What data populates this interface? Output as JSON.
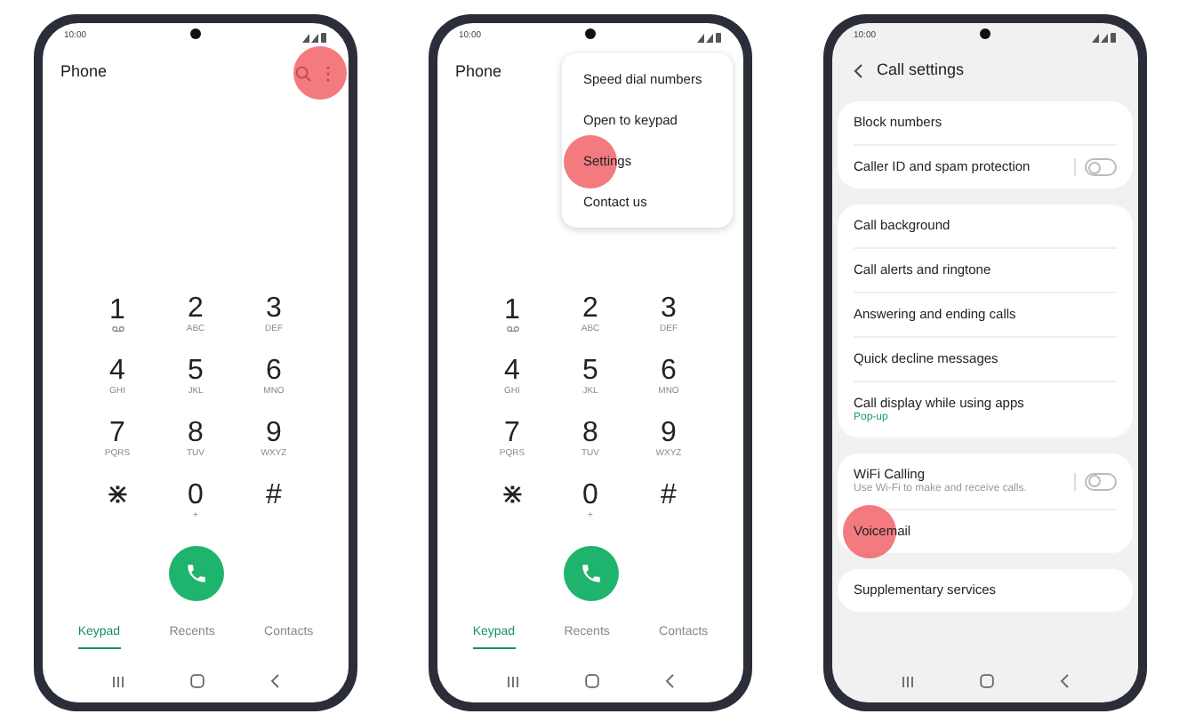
{
  "phones": [
    {
      "kind": "dialer",
      "status_time": "10:00",
      "title": "Phone",
      "more_tapped": true,
      "keys": [
        {
          "digit": "1",
          "kind": "voicemail"
        },
        {
          "digit": "2",
          "kind": "letters",
          "letters": "ABC"
        },
        {
          "digit": "3",
          "kind": "letters",
          "letters": "DEF"
        },
        {
          "digit": "4",
          "kind": "letters",
          "letters": "GHI"
        },
        {
          "digit": "5",
          "kind": "letters",
          "letters": "JKL"
        },
        {
          "digit": "6",
          "kind": "letters",
          "letters": "MNO"
        },
        {
          "digit": "7",
          "kind": "letters",
          "letters": "PQRS"
        },
        {
          "digit": "8",
          "kind": "letters",
          "letters": "TUV"
        },
        {
          "digit": "9",
          "kind": "letters",
          "letters": "WXYZ"
        },
        {
          "digit": "⋇",
          "kind": "plain"
        },
        {
          "digit": "0",
          "kind": "letters",
          "letters": "+"
        },
        {
          "digit": "#",
          "kind": "plain"
        }
      ],
      "tabs": [
        {
          "label": "Keypad",
          "selected": true
        },
        {
          "label": "Recents",
          "selected": false
        },
        {
          "label": "Contacts",
          "selected": false
        }
      ]
    },
    {
      "kind": "dialer",
      "status_time": "10:00",
      "title": "Phone",
      "menu": [
        {
          "label": "Speed dial numbers",
          "tapped": false
        },
        {
          "label": "Open to keypad",
          "tapped": false
        },
        {
          "label": "Settings",
          "tapped": true
        },
        {
          "label": "Contact us",
          "tapped": false
        }
      ],
      "keys": [
        {
          "digit": "1",
          "kind": "voicemail"
        },
        {
          "digit": "2",
          "kind": "letters",
          "letters": "ABC"
        },
        {
          "digit": "3",
          "kind": "letters",
          "letters": "DEF"
        },
        {
          "digit": "4",
          "kind": "letters",
          "letters": "GHI"
        },
        {
          "digit": "5",
          "kind": "letters",
          "letters": "JKL"
        },
        {
          "digit": "6",
          "kind": "letters",
          "letters": "MNO"
        },
        {
          "digit": "7",
          "kind": "letters",
          "letters": "PQRS"
        },
        {
          "digit": "8",
          "kind": "letters",
          "letters": "TUV"
        },
        {
          "digit": "9",
          "kind": "letters",
          "letters": "WXYZ"
        },
        {
          "digit": "⋇",
          "kind": "plain"
        },
        {
          "digit": "0",
          "kind": "letters",
          "letters": "+"
        },
        {
          "digit": "#",
          "kind": "plain"
        }
      ],
      "tabs": [
        {
          "label": "Keypad",
          "selected": true
        },
        {
          "label": "Recents",
          "selected": false
        },
        {
          "label": "Contacts",
          "selected": false
        }
      ]
    },
    {
      "kind": "settings",
      "status_time": "10:00",
      "title": "Call settings",
      "groups": [
        {
          "items": [
            {
              "label": "Block numbers",
              "kind": "link",
              "tapped": false
            },
            {
              "label": "Caller ID and spam protection",
              "kind": "toggle",
              "on": false,
              "tapped": false
            }
          ]
        },
        {
          "items": [
            {
              "label": "Call background",
              "kind": "link",
              "tapped": false
            },
            {
              "label": "Call alerts and ringtone",
              "kind": "link",
              "tapped": false
            },
            {
              "label": "Answering and ending calls",
              "kind": "link",
              "tapped": false
            },
            {
              "label": "Quick decline messages",
              "kind": "link",
              "tapped": false
            },
            {
              "label": "Call display while using apps",
              "kind": "link",
              "subtitle": {
                "text": "Pop-up",
                "color": "#1a9a6a"
              },
              "tapped": false
            }
          ]
        },
        {
          "items": [
            {
              "label": "WiFi Calling",
              "kind": "toggle",
              "on": false,
              "subtitle": {
                "text": "Use Wi-Fi to make and receive calls.",
                "color": "#999999"
              },
              "tapped": false
            },
            {
              "label": "Voicemail",
              "kind": "link",
              "tapped": true
            }
          ]
        },
        {
          "items": [
            {
              "label": "Supplementary services",
              "kind": "link",
              "tapped": false
            }
          ]
        }
      ]
    }
  ]
}
